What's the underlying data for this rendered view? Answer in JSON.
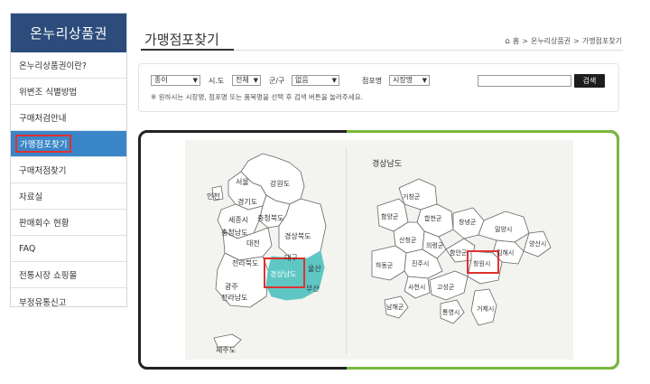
{
  "sidebar": {
    "brand": "온누리상품권",
    "items": [
      {
        "label": "온누리상품권이란?"
      },
      {
        "label": "위변조 식별방법"
      },
      {
        "label": "구매처검안내"
      },
      {
        "label": "가맹점포찾기"
      },
      {
        "label": "구매처점찾기"
      },
      {
        "label": "자료실"
      },
      {
        "label": "판매회수 현황"
      },
      {
        "label": "FAQ"
      },
      {
        "label": "전통시장 쇼핑몰"
      },
      {
        "label": "부정유통신고"
      }
    ]
  },
  "header": {
    "title": "가맹점포찾기",
    "breadcrumb": [
      "홈",
      "온누리상품권",
      "가맹점포찾기"
    ]
  },
  "search": {
    "type_value": "종이",
    "sido_label": "시.도",
    "sido_value": "전체",
    "gungu_label": "군/구",
    "gungu_value": "없음",
    "store_label": "점포명",
    "store_value": "시장명",
    "button_label": "검색",
    "hint": "※ 원하시는 시장명, 점포명 또는 품목명을 선택 후 검색 버튼을 눌러주세요."
  },
  "korea_map": {
    "regions": [
      "인천",
      "서울",
      "경기도",
      "강원도",
      "세종시",
      "충청북도",
      "충청남도",
      "대전",
      "경상북도",
      "전라북도",
      "대구",
      "울산",
      "경상남도",
      "광주",
      "부산",
      "전라남도",
      "제주도"
    ],
    "selected": "경상남도"
  },
  "gyeongnam_map": {
    "title": "경상남도",
    "regions": [
      "거창군",
      "함양군",
      "합천군",
      "창녕군",
      "밀양시",
      "양산시",
      "산청군",
      "의령군",
      "함안군",
      "김해시",
      "하동군",
      "진주시",
      "창원시",
      "사천시",
      "고성군",
      "남해군",
      "통영시",
      "거제시"
    ],
    "selected": "창원시"
  },
  "colors": {
    "brand": "#2c4c7c",
    "active": "#3a86c8",
    "highlight": "#e03030",
    "selected_region": "#5ec7c4",
    "green_frame": "#79b83c"
  }
}
